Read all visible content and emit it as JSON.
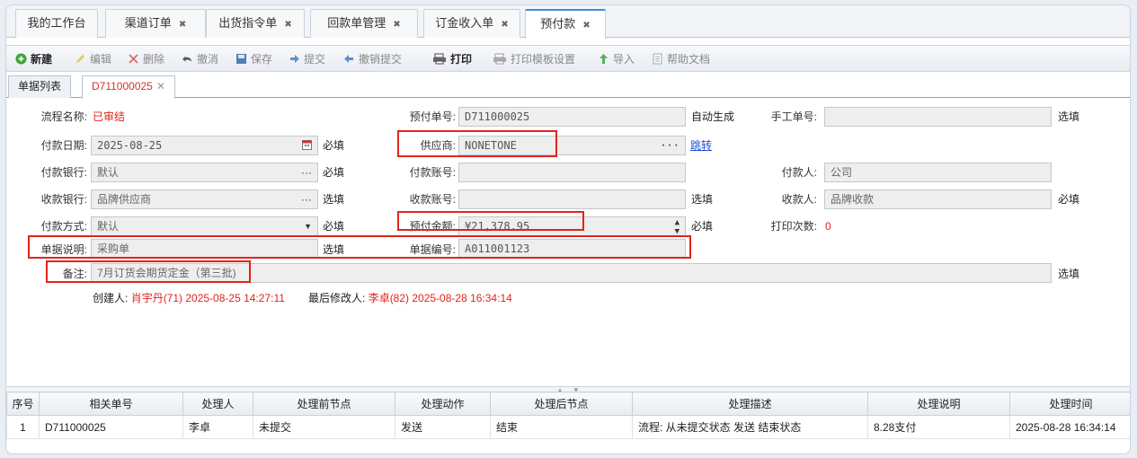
{
  "top_tabs": [
    {
      "label": "我的工作台",
      "closable": false
    },
    {
      "label": "渠道订单",
      "closable": true
    },
    {
      "label": "出货指令单",
      "closable": true
    },
    {
      "label": "回款单管理",
      "closable": true
    },
    {
      "label": "订金收入单",
      "closable": true
    },
    {
      "label": "预付款",
      "closable": true,
      "active": true
    }
  ],
  "toolbar": {
    "new": "新建",
    "edit": "编辑",
    "delete": "删除",
    "undo": "撤消",
    "save": "保存",
    "submit": "提交",
    "cancel_submit": "撤销提交",
    "print": "打印",
    "print_template": "打印模板设置",
    "import": "导入",
    "help": "帮助文档"
  },
  "sub_tabs": {
    "list": "单据列表",
    "doc": "D711000025"
  },
  "form": {
    "flow_name_label": "流程名称:",
    "flow_name_value": "已审结",
    "prepay_no_label": "预付单号:",
    "prepay_no_value": "D711000025",
    "auto_gen": "自动生成",
    "manual_no_label": "手工单号:",
    "manual_no_value": "",
    "manual_no_hint": "选填",
    "pay_date_label": "付款日期:",
    "pay_date_value": "2025-08-25",
    "pay_date_hint": "必填",
    "supplier_label": "供应商:",
    "supplier_value": "NONETONE",
    "supplier_link": "跳转",
    "pay_bank_label": "付款银行:",
    "pay_bank_value": "默认",
    "pay_bank_hint": "必填",
    "pay_account_label": "付款账号:",
    "pay_account_value": "",
    "payer_label": "付款人:",
    "payer_value": "公司",
    "recv_bank_label": "收款银行:",
    "recv_bank_value": "品牌供应商",
    "recv_bank_hint": "选填",
    "recv_account_label": "收款账号:",
    "recv_account_value": "",
    "recv_account_hint": "选填",
    "payee_label": "收款人:",
    "payee_value": "品牌收款",
    "payee_hint": "必填",
    "pay_method_label": "付款方式:",
    "pay_method_value": "默认",
    "pay_method_hint": "必填",
    "amount_label": "预付金额:",
    "amount_value": "¥21,378.95",
    "amount_hint": "必填",
    "print_count_label": "打印次数:",
    "print_count_value": "0",
    "doc_desc_label": "单据说明:",
    "doc_desc_value": "采购单",
    "doc_desc_hint": "选填",
    "doc_no_label": "单据编号:",
    "doc_no_value": "A011001123",
    "remark_label": "备注:",
    "remark_value": "7月订货会期货定金（第三批)",
    "remark_hint": "选填",
    "creator_label": "创建人:",
    "creator_value": "肖宇丹(71) 2025-08-25 14:27:11",
    "modifier_label": "最后修改人:",
    "modifier_value": "李卓(82) 2025-08-28 16:34:14"
  },
  "table": {
    "headers": [
      "序号",
      "相关单号",
      "处理人",
      "处理前节点",
      "处理动作",
      "处理后节点",
      "处理描述",
      "处理说明",
      "处理时间"
    ],
    "rows": [
      [
        "1",
        "D711000025",
        "李卓",
        "未提交",
        "发送",
        "结束",
        "流程: 从未提交状态 发送 结束状态",
        "8.28支付",
        "2025-08-28 16:34:14"
      ]
    ]
  },
  "colors": {
    "accent": "#3b8ed9",
    "highlight_box": "#e4231c",
    "required_text": "#e0241d",
    "link": "#1f4fd6"
  }
}
